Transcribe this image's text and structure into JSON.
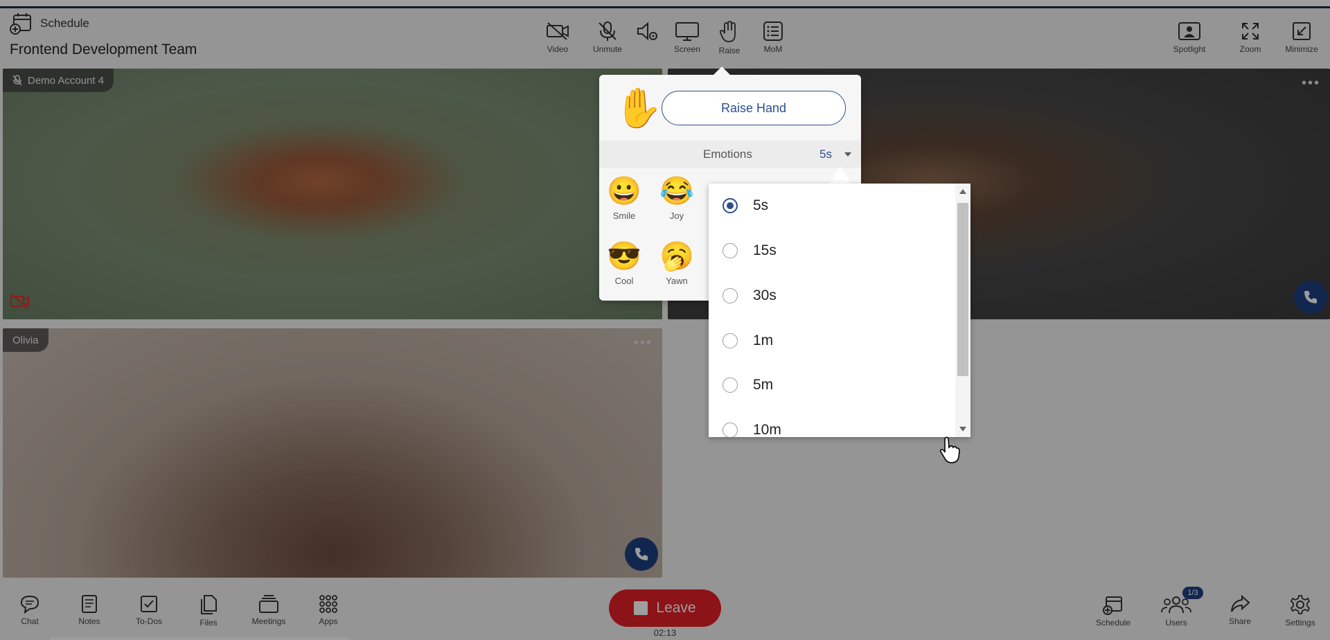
{
  "header": {
    "schedule_label": "Schedule",
    "team_title": "Frontend Development Team",
    "controls": [
      {
        "label": "Video",
        "icon": "video-off-icon"
      },
      {
        "label": "Unmute",
        "icon": "mic-off-icon"
      },
      {
        "label": "",
        "icon": "speaker-settings-icon"
      },
      {
        "label": "Screen",
        "icon": "screen-share-icon"
      },
      {
        "label": "Raise",
        "icon": "hand-icon"
      },
      {
        "label": "MoM",
        "icon": "minutes-of-meeting-icon"
      }
    ],
    "right_controls": [
      {
        "label": "Spotlight",
        "icon": "spotlight-icon"
      },
      {
        "label": "Zoom",
        "icon": "expand-icon"
      },
      {
        "label": "Minimize",
        "icon": "minimize-icon"
      }
    ]
  },
  "participants": [
    {
      "name": "Demo Account 4",
      "muted": true,
      "video_off": true
    },
    {
      "name": "",
      "muted": false,
      "video_off": false
    },
    {
      "name": "Olivia",
      "muted": false,
      "video_off": false
    }
  ],
  "raise_popover": {
    "raise_button": "Raise Hand",
    "emotions_label": "Emotions",
    "duration_value": "5s",
    "emotions": [
      {
        "glyph": "😀",
        "label": "Smile"
      },
      {
        "glyph": "😂",
        "label": "Joy"
      },
      {
        "glyph": "😎",
        "label": "Cool"
      },
      {
        "glyph": "🥱",
        "label": "Yawn"
      }
    ]
  },
  "duration_dropdown": {
    "options": [
      "5s",
      "15s",
      "30s",
      "1m",
      "5m",
      "10m"
    ],
    "selected": "5s"
  },
  "footer": {
    "left": [
      {
        "label": "Chat",
        "icon": "chat-icon"
      },
      {
        "label": "Notes",
        "icon": "notes-icon"
      },
      {
        "label": "To-Dos",
        "icon": "todo-icon"
      },
      {
        "label": "Files",
        "icon": "files-icon"
      },
      {
        "label": "Meetings",
        "icon": "meetings-icon"
      },
      {
        "label": "Apps",
        "icon": "apps-grid-icon"
      }
    ],
    "leave_label": "Leave",
    "timer": "02:13",
    "right": [
      {
        "label": "Schedule",
        "icon": "schedule-icon"
      },
      {
        "label": "Users",
        "icon": "users-icon"
      },
      {
        "label": "Share",
        "icon": "share-icon"
      },
      {
        "label": "Settings",
        "icon": "settings-icon"
      }
    ],
    "users_badge": "1/3"
  },
  "colors": {
    "accent": "#2c4f8c",
    "leave": "#e21f26",
    "call": "#1e3f82"
  }
}
